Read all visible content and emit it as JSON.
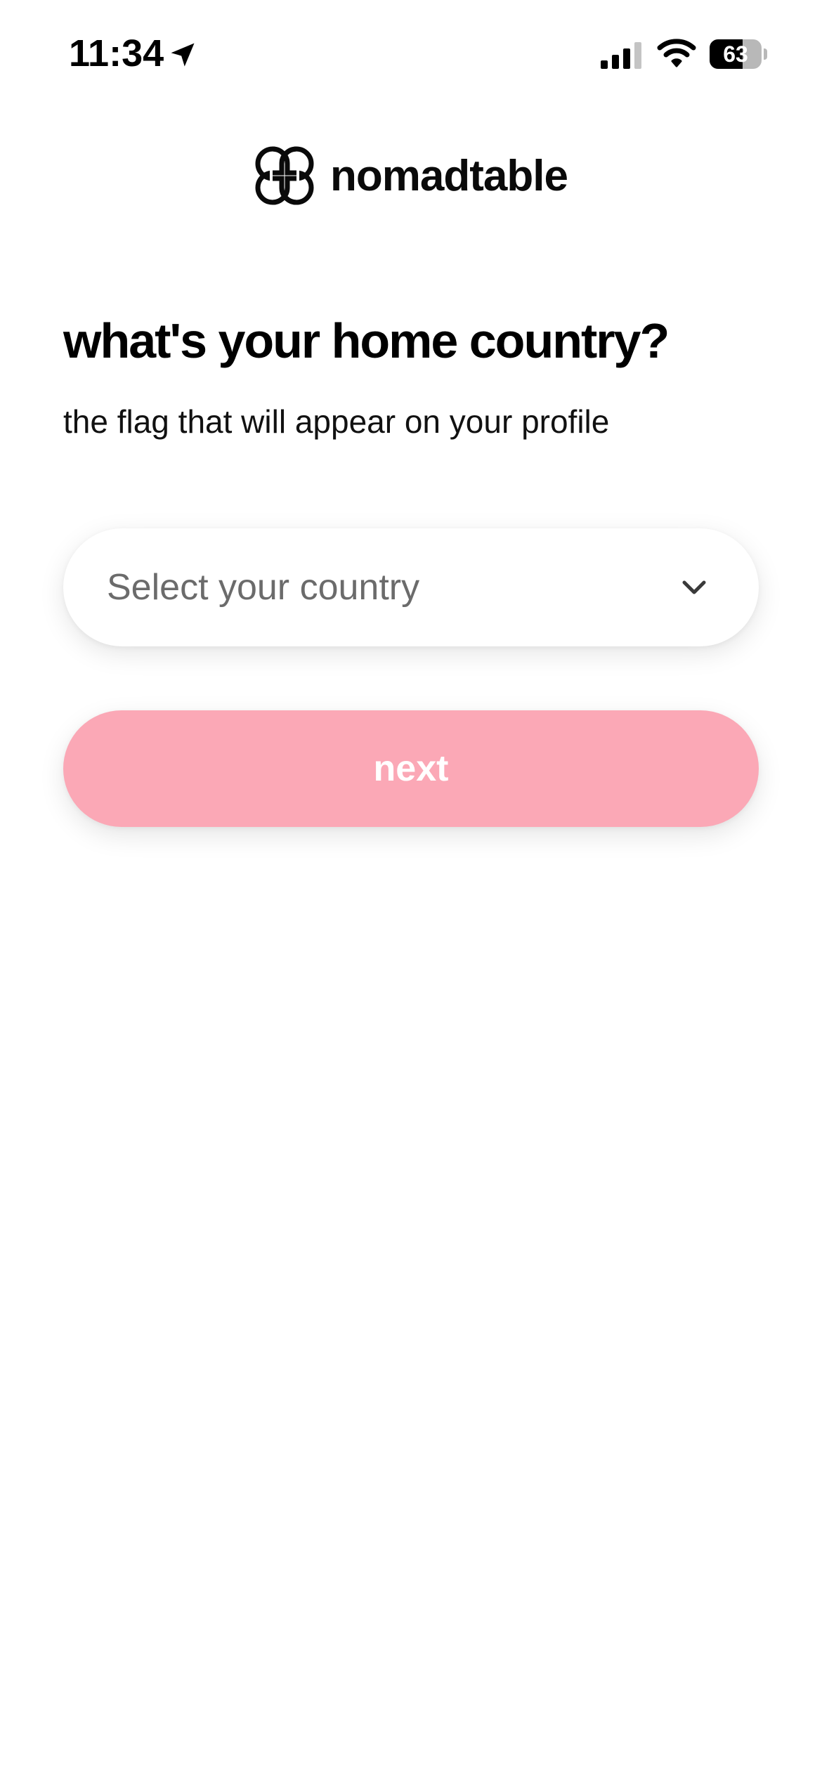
{
  "status_bar": {
    "time": "11:34",
    "battery_level": "63",
    "battery_fraction": 0.63,
    "icons": [
      "location-arrow-icon",
      "cellular-signal-icon",
      "wifi-icon",
      "battery-icon"
    ]
  },
  "logo": {
    "name": "nomadtable",
    "icon": "four-petal-logo-icon"
  },
  "page": {
    "title": "what's your home country?",
    "subtitle": "the flag that will appear on your profile"
  },
  "country_select": {
    "placeholder": "Select your country",
    "icon": "chevron-down-icon"
  },
  "next_button": {
    "label": "next"
  },
  "colors": {
    "background": "#ffffff",
    "primary_button_disabled": "#fba8b6",
    "text_primary": "#000000",
    "text_placeholder": "#6b6b6b"
  }
}
